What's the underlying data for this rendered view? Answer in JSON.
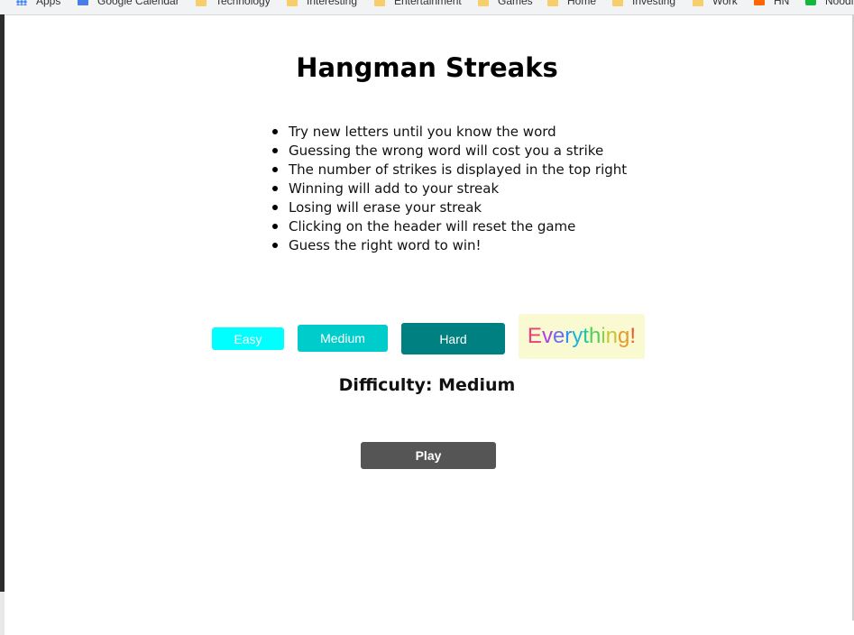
{
  "bookmarks": [
    {
      "label": "Apps",
      "icon": "apps-grid-icon"
    },
    {
      "label": "Google Calendar",
      "icon": "calendar-icon"
    },
    {
      "label": "Technology",
      "icon": "folder-icon"
    },
    {
      "label": "Interesting",
      "icon": "folder-icon"
    },
    {
      "label": "Entertainment",
      "icon": "folder-icon"
    },
    {
      "label": "Games",
      "icon": "folder-icon"
    },
    {
      "label": "Home",
      "icon": "folder-icon"
    },
    {
      "label": "Investing",
      "icon": "folder-icon"
    },
    {
      "label": "Work",
      "icon": "folder-icon"
    },
    {
      "label": "HN",
      "icon": "hn-icon"
    },
    {
      "label": "Noodl",
      "icon": "noodle-icon"
    }
  ],
  "page": {
    "title": "Hangman Streaks",
    "rules": [
      "Try new letters until you know the word",
      "Guessing the wrong word will cost you a strike",
      "The number of strikes is displayed in the top right",
      "Winning will add to your streak",
      "Losing will erase your streak",
      "Clicking on the header will reset the game",
      "Guess the right word to win!"
    ]
  },
  "difficulty_buttons": {
    "easy": "Easy",
    "medium": "Medium",
    "hard": "Hard",
    "everything": "Everything!",
    "everything_colors": [
      "#e8407a",
      "#b03ee0",
      "#6a6ef0",
      "#2f8ef5",
      "#18b7d6",
      "#1fc79a",
      "#4fcf5a",
      "#8fd04a",
      "#c9c43a",
      "#e59a2f",
      "#e85a2a"
    ]
  },
  "difficulty_status": "Difficulty: Medium",
  "play_button": "Play",
  "colors": {
    "easy": "#00ffff",
    "medium": "#00cccc",
    "hard": "#008080",
    "everything_bg": "#fafad2",
    "play": "#555555"
  }
}
